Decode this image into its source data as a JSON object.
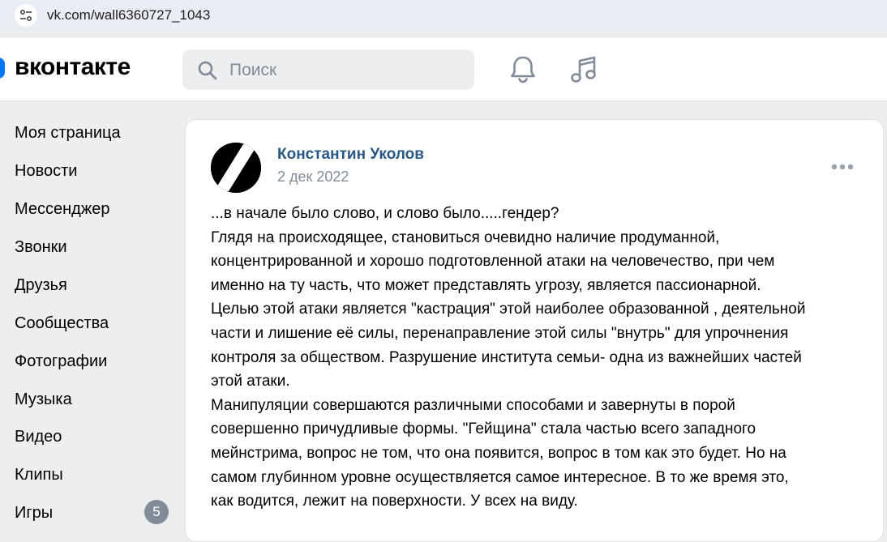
{
  "browser": {
    "url": "vk.com/wall6360727_1043"
  },
  "header": {
    "logo_text": "вконтакте",
    "search_placeholder": "Поиск",
    "accent_color": "#0077ff"
  },
  "sidebar": {
    "items": [
      {
        "label": "Моя страница"
      },
      {
        "label": "Новости"
      },
      {
        "label": "Мессенджер"
      },
      {
        "label": "Звонки"
      },
      {
        "label": "Друзья"
      },
      {
        "label": "Сообщества"
      },
      {
        "label": "Фотографии"
      },
      {
        "label": "Музыка"
      },
      {
        "label": "Видео"
      },
      {
        "label": "Клипы"
      },
      {
        "label": "Игры",
        "badge": "5"
      }
    ]
  },
  "post": {
    "author": "Константин Уколов",
    "date": "2 дек 2022",
    "lines": [
      "...в начале было слово, и слово было.....гендер?",
      "Глядя на происходящее, становиться очевидно наличие продуманной,",
      "концентрированной и хорошо подготовленной атаки на человечество, при чем",
      "именно на ту часть, что может представлять угрозу, является пассионарной.",
      "Целью этой атаки является \"кастрация\" этой наиболее образованной , деятельной",
      "части и лишение её силы, перенаправление этой силы \"внутрь\" для упрочнения",
      "контроля за обществом. Разрушение института семьи- одна из важнейших частей",
      "этой атаки.",
      "Манипуляции совершаются различными способами и завернуты в порой",
      "совершенно причудливые формы. \"Гейщина\" стала частью всего западного",
      "мейнстрима, вопрос не том, что она появится, вопрос в том как это будет. Но на",
      "самом глубинном уровне осуществляется самое интересное. В то же время это,",
      "как водится, лежит на поверхности. У всех на виду."
    ]
  }
}
